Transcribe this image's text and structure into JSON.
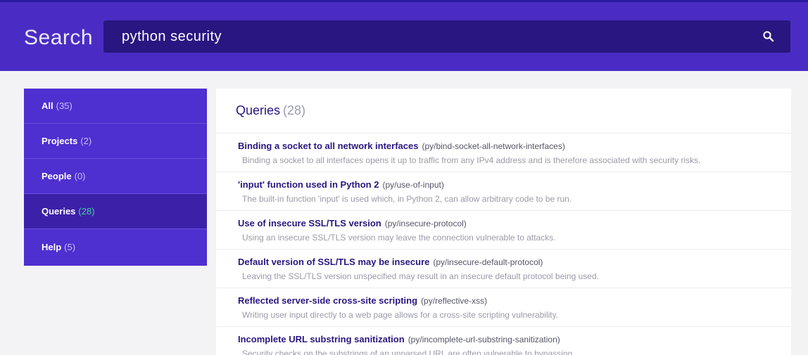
{
  "header": {
    "title": "Search",
    "query": "python security",
    "search_icon": "search-icon"
  },
  "sidebar": {
    "items": [
      {
        "label": "All",
        "count": "(35)"
      },
      {
        "label": "Projects",
        "count": "(2)"
      },
      {
        "label": "People",
        "count": "(0)"
      },
      {
        "label": "Queries",
        "count": "(28)",
        "active": true
      },
      {
        "label": "Help",
        "count": "(5)"
      }
    ]
  },
  "main": {
    "title": "Queries",
    "count": "(28)",
    "results": [
      {
        "title": "Binding a socket to all network interfaces",
        "id": "(py/bind-socket-all-network-interfaces)",
        "desc": "Binding a socket to all interfaces opens it up to traffic from any IPv4 address and is therefore associated with security risks."
      },
      {
        "title": "'input' function used in Python 2",
        "id": "(py/use-of-input)",
        "desc": "The built-in function 'input' is used which, in Python 2, can allow arbitrary code to be run."
      },
      {
        "title": "Use of insecure SSL/TLS version",
        "id": "(py/insecure-protocol)",
        "desc": "Using an insecure SSL/TLS version may leave the connection vulnerable to attacks."
      },
      {
        "title": "Default version of SSL/TLS may be insecure",
        "id": "(py/insecure-default-protocol)",
        "desc": "Leaving the SSL/TLS version unspecified may result in an insecure default protocol being used."
      },
      {
        "title": "Reflected server-side cross-site scripting",
        "id": "(py/reflective-xss)",
        "desc": "Writing user input directly to a web page allows for a cross-site scripting vulnerability."
      },
      {
        "title": "Incomplete URL substring sanitization",
        "id": "(py/incomplete-url-substring-sanitization)",
        "desc": "Security checks on the substrings of an unparsed URL are often vulnerable to bypassing."
      }
    ]
  },
  "colors": {
    "header_bg": "#4a2cc4",
    "search_bg": "#2a1680",
    "sidebar_bg": "#4e2fd0",
    "sidebar_active_bg": "#3c20a8",
    "active_count": "#44d3a6",
    "title_text": "#2a1680"
  }
}
